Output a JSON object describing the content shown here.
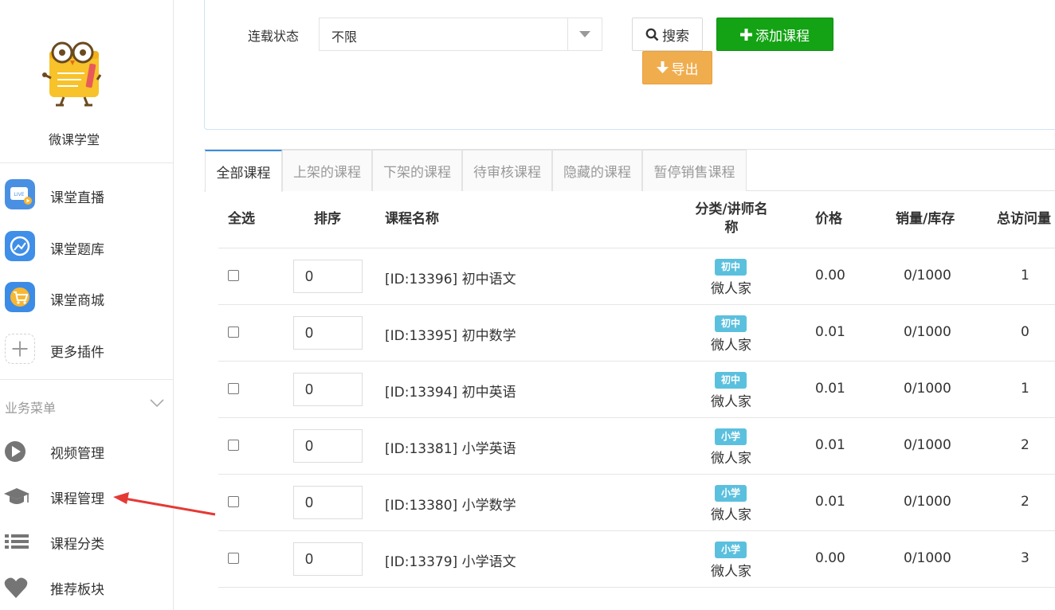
{
  "sidebar": {
    "brand_name": "微课学堂",
    "apps": [
      {
        "label": "课堂直播",
        "icon": "live-tv-icon"
      },
      {
        "label": "课堂题库",
        "icon": "question-bank-icon"
      },
      {
        "label": "课堂商城",
        "icon": "shopping-cart-icon"
      },
      {
        "label": "更多插件",
        "icon": "plus-icon"
      }
    ],
    "biz_menu_title": "业务菜单",
    "menu": [
      {
        "label": "视频管理",
        "icon": "play-icon"
      },
      {
        "label": "课程管理",
        "icon": "graduation-cap-icon"
      },
      {
        "label": "课程分类",
        "icon": "list-icon"
      },
      {
        "label": "推荐板块",
        "icon": "heart-icon"
      }
    ]
  },
  "filter": {
    "label": "连载状态",
    "select_value": "不限",
    "search_label": "搜索",
    "add_label": "添加课程",
    "export_label": "导出"
  },
  "tabs": [
    {
      "label": "全部课程",
      "active": true
    },
    {
      "label": "上架的课程",
      "active": false
    },
    {
      "label": "下架的课程",
      "active": false
    },
    {
      "label": "待审核课程",
      "active": false
    },
    {
      "label": "隐藏的课程",
      "active": false
    },
    {
      "label": "暂停销售课程",
      "active": false
    }
  ],
  "table": {
    "headers": {
      "select_all": "全选",
      "sort": "排序",
      "name": "课程名称",
      "category_line1": "分类/讲师名",
      "category_line2": "称",
      "price": "价格",
      "sales_stock": "销量/库存",
      "visits": "总访问量"
    },
    "rows": [
      {
        "sort": "0",
        "name": "[ID:13396] 初中语文",
        "category": "初中",
        "teacher": "微人家",
        "price": "0.00",
        "sales": "0/1000",
        "visits": "1"
      },
      {
        "sort": "0",
        "name": "[ID:13395] 初中数学",
        "category": "初中",
        "teacher": "微人家",
        "price": "0.01",
        "sales": "0/1000",
        "visits": "0"
      },
      {
        "sort": "0",
        "name": "[ID:13394] 初中英语",
        "category": "初中",
        "teacher": "微人家",
        "price": "0.01",
        "sales": "0/1000",
        "visits": "1"
      },
      {
        "sort": "0",
        "name": "[ID:13381] 小学英语",
        "category": "小学",
        "teacher": "微人家",
        "price": "0.01",
        "sales": "0/1000",
        "visits": "2"
      },
      {
        "sort": "0",
        "name": "[ID:13380] 小学数学",
        "category": "小学",
        "teacher": "微人家",
        "price": "0.01",
        "sales": "0/1000",
        "visits": "2"
      },
      {
        "sort": "0",
        "name": "[ID:13379] 小学语文",
        "category": "小学",
        "teacher": "微人家",
        "price": "0.00",
        "sales": "0/1000",
        "visits": "3"
      }
    ]
  },
  "colors": {
    "add_button": "#14a314",
    "export_button": "#f0ad4e",
    "badge": "#5bc0de",
    "active_tab": "#3c8dde",
    "annotation_arrow": "#e53935"
  }
}
